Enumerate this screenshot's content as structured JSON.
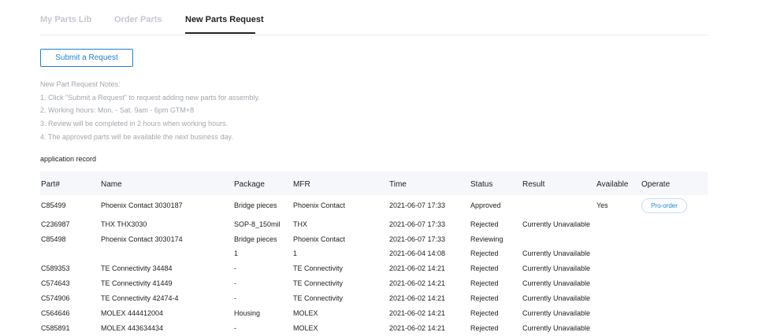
{
  "tabs": [
    {
      "label": "My Parts Lib"
    },
    {
      "label": "Order Parts"
    },
    {
      "label": "New Parts Request"
    }
  ],
  "submit_button": "Submit a Request",
  "notes": [
    "New Part Request Notes:",
    "1. Click \"Submit a Request\" to request adding new parts for assembly.",
    "2. Working hours: Mon. - Sat. 9am - 6pm GTM+8",
    "3. Review will be completed in 2 hours when working hours.",
    "4. The approved parts will be available the next business day."
  ],
  "record_title": "application record",
  "columns": [
    "Part#",
    "Name",
    "Package",
    "MFR",
    "Time",
    "Status",
    "Result",
    "Available",
    "Operate"
  ],
  "rows": [
    {
      "part": "C85499",
      "name": "Phoenix Contact 3030187",
      "package": "Bridge pieces",
      "mfr": "Phoenix Contact",
      "time": "2021-06-07 17:33",
      "status": "Approved",
      "result": "",
      "available": "Yes",
      "operate": "Pro-order"
    },
    {
      "part": "C236987",
      "name": "THX THX3030",
      "package": "SOP-8_150mil",
      "mfr": "THX",
      "time": "2021-06-07 17:33",
      "status": "Rejected",
      "result": "Currently Unavailable",
      "available": "",
      "operate": ""
    },
    {
      "part": "C85498",
      "name": "Phoenix Contact 3030174",
      "package": "Bridge pieces",
      "mfr": "Phoenix Contact",
      "time": "2021-06-07 17:33",
      "status": "Reviewing",
      "result": "",
      "available": "",
      "operate": ""
    },
    {
      "part": "",
      "name": "",
      "package": "1",
      "mfr": "1",
      "time": "2021-06-04 14:08",
      "status": "Rejected",
      "result": "Currently Unavailable",
      "available": "",
      "operate": ""
    },
    {
      "part": "C589353",
      "name": "TE Connectivity 34484",
      "package": "-",
      "mfr": "TE Connectivity",
      "time": "2021-06-02 14:21",
      "status": "Rejected",
      "result": "Currently Unavailable",
      "available": "",
      "operate": ""
    },
    {
      "part": "C574643",
      "name": "TE Connectivity 41449",
      "package": "-",
      "mfr": "TE Connectivity",
      "time": "2021-06-02 14:21",
      "status": "Rejected",
      "result": "Currently Unavailable",
      "available": "",
      "operate": ""
    },
    {
      "part": "C574906",
      "name": "TE Connectivity 42474-4",
      "package": "-",
      "mfr": "TE Connectivity",
      "time": "2021-06-02 14:21",
      "status": "Rejected",
      "result": "Currently Unavailable",
      "available": "",
      "operate": ""
    },
    {
      "part": "C564646",
      "name": "MOLEX 444412004",
      "package": "Housing",
      "mfr": "MOLEX",
      "time": "2021-06-02 14:21",
      "status": "Rejected",
      "result": "Currently Unavailable",
      "available": "",
      "operate": ""
    },
    {
      "part": "C585891",
      "name": "MOLEX 443634434",
      "package": "-",
      "mfr": "MOLEX",
      "time": "2021-06-02 14:21",
      "status": "Rejected",
      "result": "Currently Unavailable",
      "available": "",
      "operate": ""
    }
  ]
}
